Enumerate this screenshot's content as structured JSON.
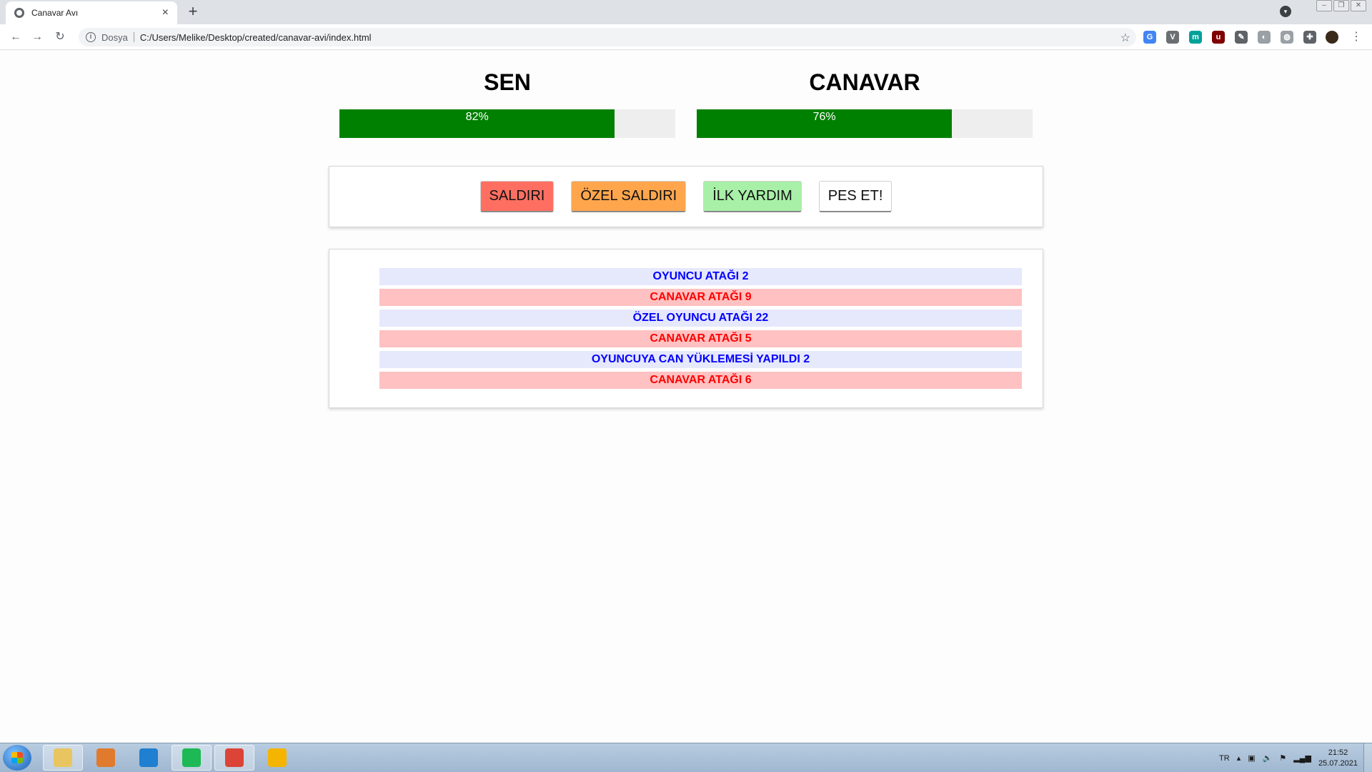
{
  "browser": {
    "tab_title": "Canavar Avı",
    "tab_close": "×",
    "new_tab": "+",
    "scheme_label": "Dosya",
    "url": "C:/Users/Melike/Desktop/created/canavar-avi/index.html",
    "nav": {
      "back": "←",
      "forward": "→",
      "reload": "↻"
    },
    "extensions": [
      {
        "name": "translate-extension-icon",
        "color": "#4285f4",
        "glyph": "G"
      },
      {
        "name": "vue-devtools-extension-icon",
        "color": "#6b6f73",
        "glyph": "V"
      },
      {
        "name": "m-extension-icon",
        "color": "#00a19a",
        "glyph": "m"
      },
      {
        "name": "ublock-extension-icon",
        "color": "#800000",
        "glyph": "u"
      },
      {
        "name": "eyedropper-extension-icon",
        "color": "#5f6368",
        "glyph": "✎"
      },
      {
        "name": "extension-icon-grey",
        "color": "#9aa0a6",
        "glyph": "◐"
      },
      {
        "name": "globe-extension-icon",
        "color": "#9aa0a6",
        "glyph": "◍"
      },
      {
        "name": "puzzle-extensions-icon",
        "color": "#5f6368",
        "glyph": "✚"
      }
    ]
  },
  "game": {
    "player": {
      "label": "SEN",
      "health": 82,
      "health_text": "82%"
    },
    "monster": {
      "label": "CANAVAR",
      "health": 76,
      "health_text": "76%"
    },
    "controls": {
      "attack": "SALDIRI",
      "special_attack": "ÖZEL SALDIRI",
      "heal": "İLK YARDIM",
      "give_up": "PES ET!"
    },
    "log": [
      {
        "who": "player",
        "text": "OYUNCU ATAĞI 2"
      },
      {
        "who": "monster",
        "text": "CANAVAR ATAĞI 9"
      },
      {
        "who": "player",
        "text": "ÖZEL OYUNCU ATAĞI 22"
      },
      {
        "who": "monster",
        "text": "CANAVAR ATAĞI 5"
      },
      {
        "who": "player",
        "text": "OYUNCUYA CAN YÜKLEMESİ YAPILDI 2"
      },
      {
        "who": "monster",
        "text": "CANAVAR ATAĞI 6"
      }
    ],
    "colors": {
      "health_fill": "#008000",
      "attack": "#ff6f61",
      "special_attack": "#ffa64d",
      "heal": "#a8f0a8",
      "player_log_bg": "#e6e8fc",
      "monster_log_bg": "#ffc1c1"
    }
  },
  "taskbar": {
    "language": "TR",
    "time": "21:52",
    "date": "25.07.2021",
    "apps": [
      {
        "name": "explorer-taskbar-icon",
        "color": "#e8c560",
        "active": true
      },
      {
        "name": "media-player-taskbar-icon",
        "color": "#e07b2e",
        "active": false
      },
      {
        "name": "vscode-taskbar-icon",
        "color": "#1f7fd1",
        "active": false
      },
      {
        "name": "spotify-taskbar-icon",
        "color": "#1db954",
        "active": true
      },
      {
        "name": "chrome-taskbar-icon",
        "color": "#db4437",
        "active": true
      },
      {
        "name": "app-taskbar-icon",
        "color": "#f4b400",
        "active": false
      }
    ]
  }
}
